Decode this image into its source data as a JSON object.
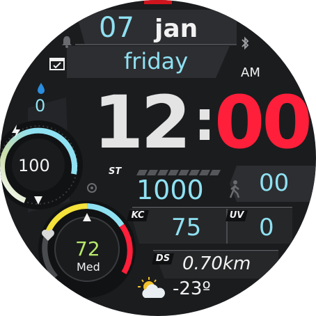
{
  "date": {
    "day": "07",
    "month": "jan",
    "weekday": "friday"
  },
  "time": {
    "hours": "12",
    "separator": ":",
    "minutes": "00",
    "ampm": "AM"
  },
  "battery": {
    "value": "100",
    "level": 1.0
  },
  "weather_drop": {
    "value": "0"
  },
  "heart": {
    "value": "72",
    "zone": "Med"
  },
  "steps": {
    "label": "ST",
    "value": "1000",
    "goal_progress_segments": 0
  },
  "kcal": {
    "label": "KC",
    "value": "75"
  },
  "uv": {
    "label": "UV",
    "value": "0"
  },
  "distance": {
    "label": "DS",
    "value": "0.70km"
  },
  "temperature": {
    "value": "-23º"
  },
  "floors": {
    "value": "00"
  },
  "icons": [
    "bell-icon",
    "calendar-icon",
    "bluetooth-icon",
    "drop-icon",
    "bolt-icon",
    "heart-icon",
    "walker-icon",
    "weather-sun-cloud-icon"
  ],
  "colors": {
    "accent_red": "#ff1f3a",
    "accent_cyan": "#8fe1f2",
    "panel": "#2a2b2e",
    "background": "#1b1c1e"
  }
}
